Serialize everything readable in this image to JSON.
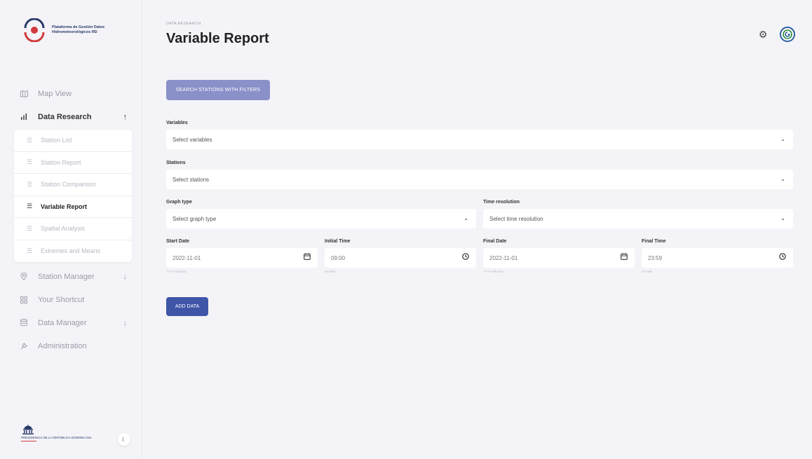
{
  "brand": {
    "name": "Plataforma de Gestión Datos Hidrometeorológicos RD",
    "footer_name": "PRESIDENCIA DE LA REPÚBLICA DOMINICANA"
  },
  "sidebar": {
    "items": [
      {
        "label": "Map View",
        "icon": "map-icon"
      },
      {
        "label": "Data Research",
        "icon": "bar-chart-icon",
        "chevron": "↑"
      },
      {
        "label": "Station Manager",
        "icon": "location-pin-icon",
        "chevron": "↓"
      },
      {
        "label": "Your Shortcut",
        "icon": "grid-icon"
      },
      {
        "label": "Data Manager",
        "icon": "database-icon",
        "chevron": "↓"
      },
      {
        "label": "Administration",
        "icon": "wrench-icon"
      }
    ],
    "sub_items": [
      {
        "label": "Station List"
      },
      {
        "label": "Station Report"
      },
      {
        "label": "Station Comparison"
      },
      {
        "label": "Variable Report"
      },
      {
        "label": "Spatial Analysis"
      },
      {
        "label": "Extremes and Means"
      }
    ]
  },
  "header": {
    "breadcrumb": "DATA RESEARCH",
    "title": "Variable Report"
  },
  "form": {
    "search_button": "SEARCH STATIONS WITH FILTERS",
    "variables_label": "Variables",
    "variables_placeholder": "Select variables",
    "stations_label": "Stations",
    "stations_placeholder": "Select stations",
    "graph_type_label": "Graph type",
    "graph_type_placeholder": "Select graph type",
    "time_res_label": "Time resolution",
    "time_res_placeholder": "Select time resolution",
    "start_date_label": "Start Date",
    "start_date_value": "2022-11-01",
    "start_date_hint": "YYYY-MM-DD",
    "initial_time_label": "Initial Time",
    "initial_time_value": "09:00",
    "initial_time_hint": "HH:MM",
    "final_date_label": "Final Date",
    "final_date_value": "2022-11-01",
    "final_date_hint": "YYYY-MM-DD",
    "final_time_label": "Final Time",
    "final_time_value": "23:59",
    "final_time_hint": "HH:MM",
    "add_button": "ADD DATA"
  },
  "colors": {
    "primary": "#3f55a8",
    "primary_light": "#8a90c8",
    "background": "#f4f4f8"
  }
}
